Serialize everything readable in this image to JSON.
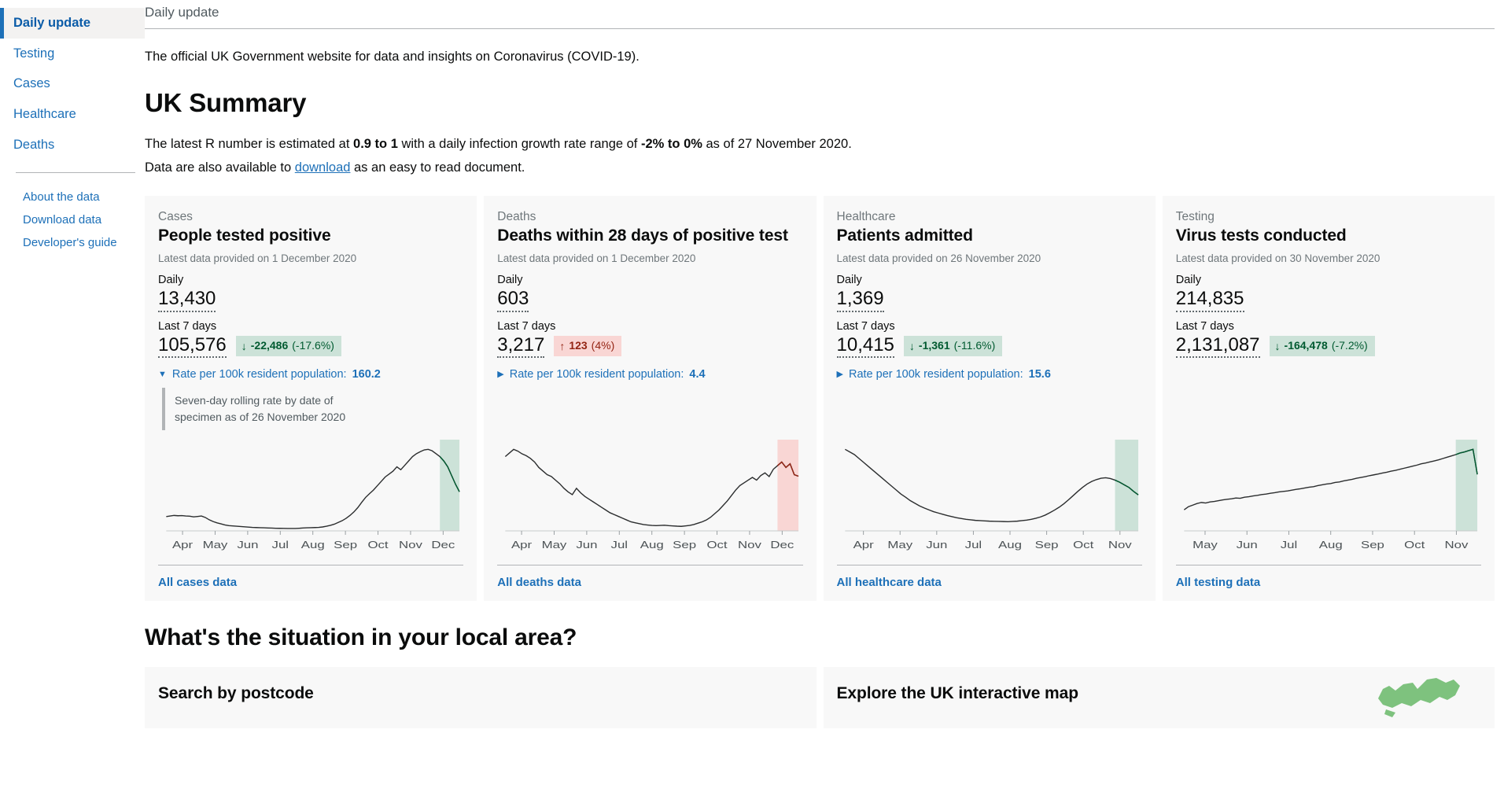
{
  "sidebar": {
    "primary": [
      {
        "label": "Daily update",
        "active": true
      },
      {
        "label": "Testing",
        "active": false
      },
      {
        "label": "Cases",
        "active": false
      },
      {
        "label": "Healthcare",
        "active": false
      },
      {
        "label": "Deaths",
        "active": false
      }
    ],
    "secondary": [
      {
        "label": "About the data"
      },
      {
        "label": "Download data"
      },
      {
        "label": "Developer's guide"
      }
    ]
  },
  "header": {
    "breadcrumb": "Daily update",
    "intro": "The official UK Government website for data and insights on Coronavirus (COVID-19).",
    "title": "UK Summary"
  },
  "r_number": {
    "prefix": "The latest R number is estimated at ",
    "value": "0.9 to 1",
    "middle": " with a daily infection growth rate range of ",
    "growth": "-2% to 0%",
    "suffix": " as of 27 November 2020.",
    "download_prefix": "Data are also available to ",
    "download_label": "download",
    "download_suffix": " as an easy to read document."
  },
  "cards": [
    {
      "category": "Cases",
      "title": "People tested positive",
      "date": "Latest data provided on 1 December 2020",
      "daily_label": "Daily",
      "daily_value": "13,430",
      "weekly_label": "Last 7 days",
      "weekly_value": "105,576",
      "badge": {
        "direction": "down",
        "arrow": "↓",
        "number": "-22,486",
        "percent": "(-17.6%)"
      },
      "rate_toggle": {
        "triangle": "▼",
        "label": "Rate per 100k resident population:",
        "value": "160.2",
        "expanded": true
      },
      "rate_detail": "Seven-day rolling rate by date of specimen as of 26 November 2020",
      "footer_link": "All cases data",
      "accent": "#005a30"
    },
    {
      "category": "Deaths",
      "title": "Deaths within 28 days of positive test",
      "date": "Latest data provided on 1 December 2020",
      "daily_label": "Daily",
      "daily_value": "603",
      "weekly_label": "Last 7 days",
      "weekly_value": "3,217",
      "badge": {
        "direction": "up",
        "arrow": "↑",
        "number": "123",
        "percent": "(4%)"
      },
      "rate_toggle": {
        "triangle": "▶",
        "label": "Rate per 100k resident population:",
        "value": "4.4",
        "expanded": false
      },
      "rate_detail": "",
      "footer_link": "All deaths data",
      "accent": "#942514"
    },
    {
      "category": "Healthcare",
      "title": "Patients admitted",
      "date": "Latest data provided on 26 November 2020",
      "daily_label": "Daily",
      "daily_value": "1,369",
      "weekly_label": "Last 7 days",
      "weekly_value": "10,415",
      "badge": {
        "direction": "down",
        "arrow": "↓",
        "number": "-1,361",
        "percent": "(-11.6%)"
      },
      "rate_toggle": {
        "triangle": "▶",
        "label": "Rate per 100k resident population:",
        "value": "15.6",
        "expanded": false
      },
      "rate_detail": "",
      "footer_link": "All healthcare data",
      "accent": "#005a30"
    },
    {
      "category": "Testing",
      "title": "Virus tests conducted",
      "date": "Latest data provided on 30 November 2020",
      "daily_label": "Daily",
      "daily_value": "214,835",
      "weekly_label": "Last 7 days",
      "weekly_value": "2,131,087",
      "badge": {
        "direction": "down",
        "arrow": "↓",
        "number": "-164,478",
        "percent": "(-7.2%)"
      },
      "rate_toggle": null,
      "rate_detail": "",
      "footer_link": "All testing data",
      "accent": "#005a30"
    }
  ],
  "local": {
    "heading": "What's the situation in your local area?",
    "postcode_card": "Search by postcode",
    "map_card": "Explore the UK interactive map"
  },
  "chart_data": [
    {
      "type": "line",
      "title": "People tested positive",
      "xlabel": "",
      "ylabel": "",
      "tick_labels": [
        "Apr",
        "May",
        "Jun",
        "Jul",
        "Aug",
        "Sep",
        "Oct",
        "Nov",
        "Dec"
      ],
      "line_color": "#2b2d2e",
      "highlight_color": "#cce2d8",
      "highlight_line_color": "#005a30",
      "ylim": [
        0,
        30000
      ],
      "values": [
        4900,
        5100,
        5300,
        5200,
        5250,
        5100,
        5050,
        4800,
        4950,
        5100,
        4600,
        3800,
        3200,
        2750,
        2400,
        2050,
        1800,
        1700,
        1600,
        1500,
        1400,
        1300,
        1200,
        1150,
        1100,
        1050,
        1000,
        950,
        900,
        880,
        860,
        840,
        830,
        820,
        900,
        1000,
        1050,
        1100,
        1150,
        1200,
        1350,
        1600,
        1900,
        2300,
        2900,
        3500,
        4300,
        5300,
        6500,
        8000,
        9800,
        11500,
        12800,
        14000,
        15500,
        17000,
        18500,
        19500,
        20500,
        22000,
        21000,
        22500,
        24000,
        25500,
        26500,
        27200,
        27800,
        28000,
        27500,
        26500,
        25500,
        24000,
        22000,
        19000,
        16000,
        13430
      ]
    },
    {
      "type": "line",
      "title": "Deaths within 28 days of positive test",
      "tick_labels": [
        "Apr",
        "May",
        "Jun",
        "Jul",
        "Aug",
        "Sep",
        "Oct",
        "Nov",
        "Dec"
      ],
      "line_color": "#2b2d2e",
      "highlight_color": "#f9d6d4",
      "highlight_line_color": "#942514",
      "ylim": [
        0,
        1000
      ],
      "values": [
        820,
        860,
        900,
        880,
        850,
        830,
        800,
        760,
        700,
        660,
        620,
        600,
        560,
        520,
        470,
        430,
        400,
        470,
        420,
        380,
        350,
        320,
        290,
        260,
        230,
        200,
        180,
        160,
        140,
        120,
        100,
        90,
        80,
        70,
        65,
        60,
        58,
        60,
        62,
        58,
        55,
        52,
        50,
        55,
        60,
        70,
        85,
        100,
        120,
        150,
        190,
        230,
        280,
        330,
        390,
        450,
        500,
        530,
        560,
        590,
        560,
        610,
        640,
        600,
        680,
        720,
        760,
        700,
        740,
        620,
        603
      ]
    },
    {
      "type": "line",
      "title": "Patients admitted",
      "tick_labels": [
        "Apr",
        "May",
        "Jun",
        "Jul",
        "Aug",
        "Sep",
        "Oct",
        "Nov"
      ],
      "line_color": "#2b2d2e",
      "highlight_color": "#cce2d8",
      "highlight_line_color": "#005a30",
      "ylim": [
        0,
        3500
      ],
      "values": [
        3100,
        3000,
        2900,
        2750,
        2600,
        2450,
        2300,
        2150,
        2000,
        1850,
        1700,
        1550,
        1400,
        1280,
        1150,
        1050,
        950,
        870,
        800,
        730,
        680,
        630,
        580,
        540,
        500,
        470,
        440,
        420,
        400,
        390,
        380,
        370,
        365,
        360,
        355,
        350,
        360,
        370,
        390,
        410,
        440,
        480,
        530,
        600,
        690,
        790,
        900,
        1030,
        1180,
        1340,
        1500,
        1650,
        1780,
        1880,
        1950,
        2000,
        2020,
        1990,
        1930,
        1850,
        1750,
        1650,
        1500,
        1369
      ]
    },
    {
      "type": "line",
      "title": "Virus tests conducted",
      "tick_labels": [
        "May",
        "Jun",
        "Jul",
        "Aug",
        "Sep",
        "Oct",
        "Nov"
      ],
      "line_color": "#2b2d2e",
      "highlight_color": "#cce2d8",
      "highlight_line_color": "#005a30",
      "ylim": [
        0,
        350000
      ],
      "values": [
        80000,
        92000,
        98000,
        104000,
        108000,
        106000,
        110000,
        112000,
        115000,
        118000,
        120000,
        122000,
        125000,
        124000,
        128000,
        130000,
        133000,
        135000,
        138000,
        140000,
        143000,
        145000,
        148000,
        150000,
        152000,
        155000,
        158000,
        160000,
        163000,
        166000,
        168000,
        172000,
        175000,
        178000,
        180000,
        184000,
        186000,
        190000,
        193000,
        196000,
        200000,
        203000,
        206000,
        210000,
        213000,
        216000,
        220000,
        223000,
        227000,
        230000,
        234000,
        238000,
        242000,
        246000,
        250000,
        255000,
        258000,
        262000,
        266000,
        270000,
        275000,
        280000,
        285000,
        290000,
        296000,
        300000,
        305000,
        310000,
        214835
      ]
    }
  ]
}
